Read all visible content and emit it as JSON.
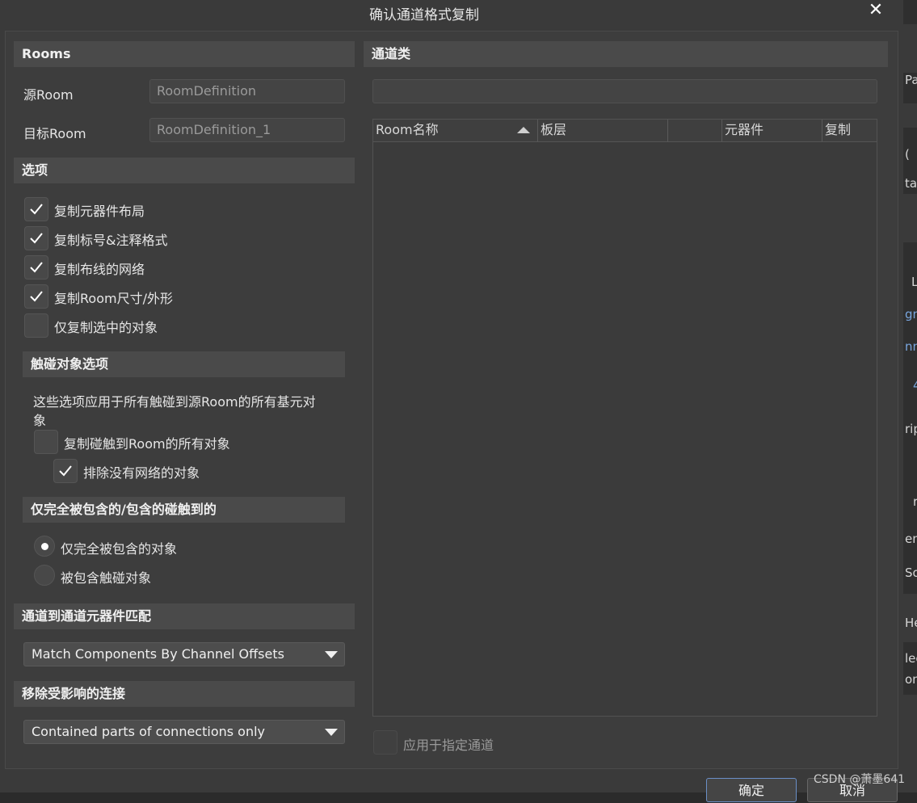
{
  "dialog": {
    "title": "确认通道格式复制",
    "close_label": "✕"
  },
  "rooms": {
    "header": "Rooms",
    "source_label": "源Room",
    "source_value": "RoomDefinition",
    "target_label": "目标Room",
    "target_value": "RoomDefinition_1"
  },
  "options": {
    "header": "选项",
    "items": [
      {
        "label": "复制元器件布局",
        "checked": true
      },
      {
        "label": "复制标号&注释格式",
        "checked": true
      },
      {
        "label": "复制布线的网络",
        "checked": true
      },
      {
        "label": "复制Room尺寸/外形",
        "checked": true
      },
      {
        "label": "仅复制选中的对象",
        "checked": false
      }
    ]
  },
  "touch": {
    "header": "触碰对象选项",
    "description_line1": "这些选项应用于所有触碰到源Room的所有基元对",
    "description_line2": "象",
    "copy_touching": {
      "label": "复制碰触到Room的所有对象",
      "checked": false
    },
    "exclude_no_net": {
      "label": "排除没有网络的对象",
      "checked": true
    }
  },
  "contain": {
    "header": "仅完全被包含的/包含的碰触到的",
    "radio1": {
      "label": "仅完全被包含的对象",
      "selected": true
    },
    "radio2": {
      "label": "被包含触碰对象",
      "selected": false
    }
  },
  "match": {
    "header": "通道到通道元器件匹配",
    "selected": "Match Components By Channel Offsets"
  },
  "remove": {
    "header": "移除受影响的连接",
    "selected": "Contained parts of connections only"
  },
  "channel_class": {
    "header": "通道类",
    "value": "",
    "columns": [
      "Room名称",
      "板层",
      "",
      "元器件",
      "复制"
    ],
    "rows": [],
    "apply_label": "应用于指定通道",
    "apply_checked": false
  },
  "buttons": {
    "ok": "确定",
    "cancel": "取消"
  },
  "background_fragments": [
    "Par",
    "(",
    "ta",
    "L",
    "gn",
    "nn",
    "4",
    "rip",
    "r",
    "en",
    "So",
    "He",
    "lec",
    "on"
  ],
  "watermark": "CSDN @萧墨641",
  "colors": {
    "dialog_bg": "#3a3a3a",
    "section_bg": "#4a4a4a",
    "accent": "#6a8fc7"
  }
}
